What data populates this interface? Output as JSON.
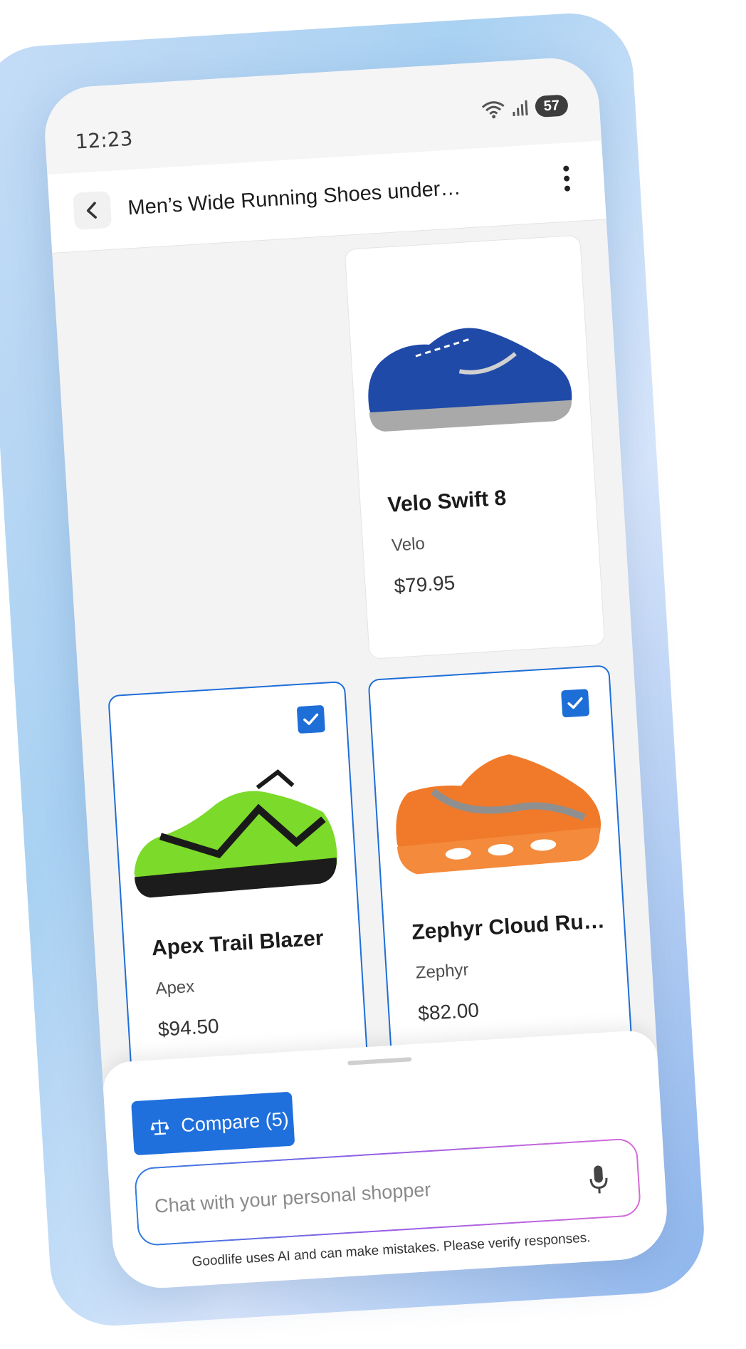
{
  "status_bar": {
    "time": "12:23",
    "battery": "57"
  },
  "header": {
    "title": "Men’s Wide Running Shoes under…"
  },
  "products": [
    {
      "name": "Velo Swift 8",
      "brand": "Velo",
      "price": "$79.95",
      "color": "#1f4aa8",
      "selected": false
    },
    {
      "name": "Apex Trail Blazer",
      "brand": "Apex",
      "price": "$94.50",
      "color": "#7cda2a",
      "selected": true
    },
    {
      "name": "Zephyr Cloud Runn…",
      "brand": "Zephyr",
      "price": "$82.00",
      "color": "#f07a2a",
      "selected": true
    }
  ],
  "compare": {
    "label": "Compare (5)"
  },
  "chat": {
    "placeholder": "Chat with your personal shopper"
  },
  "disclaimer": "Goodlife uses AI and can make mistakes. Please verify responses.",
  "colors": {
    "accent": "#1e6ed8",
    "background": "#f3f3f3"
  }
}
